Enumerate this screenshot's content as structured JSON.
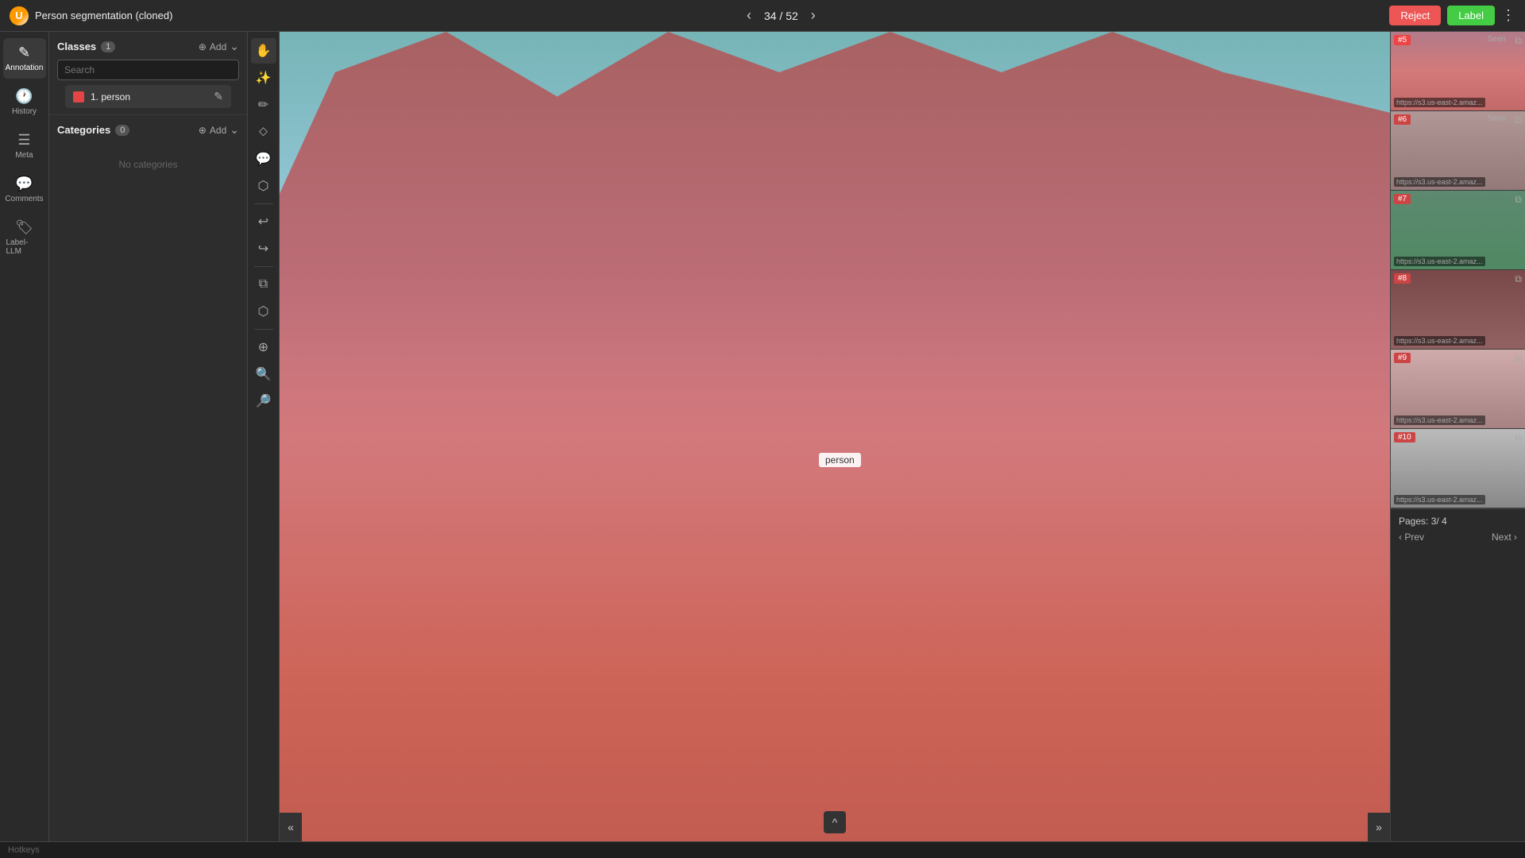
{
  "topbar": {
    "title": "Person segmentation (cloned)",
    "logo_text": "U",
    "current_page": "34",
    "total_pages": "52",
    "page_indicator": "34 / 52",
    "reject_label": "Reject",
    "label_label": "Label",
    "more_icon": "⋮"
  },
  "sidebar": {
    "items": [
      {
        "id": "annotation",
        "icon": "✎",
        "label": "Annotation"
      },
      {
        "id": "history",
        "icon": "🕐",
        "label": "History"
      },
      {
        "id": "meta",
        "icon": "☰",
        "label": "Meta"
      },
      {
        "id": "comments",
        "icon": "💬",
        "label": "Comments"
      },
      {
        "id": "label-llm",
        "icon": "🏷",
        "label": "Label-LLM"
      }
    ]
  },
  "classes_panel": {
    "title": "Classes",
    "count": "1",
    "add_label": "Add",
    "search_placeholder": "Search",
    "search_value": "",
    "classes": [
      {
        "id": 1,
        "name": "1. person",
        "color": "#e44444"
      }
    ],
    "categories_title": "Categories",
    "categories_count": "0",
    "no_categories_text": "No categories"
  },
  "tools": [
    {
      "id": "select",
      "icon": "✋",
      "label": "Select"
    },
    {
      "id": "smart",
      "icon": "✨",
      "label": "Smart"
    },
    {
      "id": "brush",
      "icon": "✏",
      "label": "Brush"
    },
    {
      "id": "erase",
      "icon": "⬦",
      "label": "Erase"
    },
    {
      "id": "comment",
      "icon": "💬",
      "label": "Comment"
    },
    {
      "id": "filter",
      "icon": "⬡",
      "label": "Filter"
    },
    {
      "id": "undo",
      "icon": "↩",
      "label": "Undo"
    },
    {
      "id": "redo",
      "icon": "↪",
      "label": "Redo"
    },
    {
      "id": "copy",
      "icon": "⧉",
      "label": "Copy"
    },
    {
      "id": "paste",
      "icon": "⬡",
      "label": "Paste"
    },
    {
      "id": "zoom-fit",
      "icon": "⊕",
      "label": "Zoom fit"
    },
    {
      "id": "zoom-in",
      "icon": "🔍",
      "label": "Zoom in"
    },
    {
      "id": "zoom-out",
      "icon": "🔎",
      "label": "Zoom out"
    }
  ],
  "canvas": {
    "annotation_label": "person"
  },
  "thumbnails": [
    {
      "id": "#5",
      "seen": "Seen",
      "url": "https://s3.us-east-2.amaz...",
      "has_red": true,
      "has_green": false,
      "active": true
    },
    {
      "id": "#6",
      "seen": "Seen",
      "url": "https://s3.us-east-2.amaz...",
      "has_red": false,
      "has_green": false,
      "active": false
    },
    {
      "id": "#7",
      "seen": "",
      "url": "https://s3.us-east-2.amaz...",
      "has_red": true,
      "has_green": true,
      "active": false
    },
    {
      "id": "#8",
      "seen": "",
      "url": "https://s3.us-east-2.amaz...",
      "has_red": true,
      "has_green": false,
      "active": false
    },
    {
      "id": "#9",
      "seen": "",
      "url": "https://s3.us-east-2.amaz...",
      "has_red": true,
      "has_green": false,
      "active": false
    },
    {
      "id": "#10",
      "seen": "",
      "url": "https://s3.us-east-2.amaz...",
      "has_red": false,
      "has_green": false,
      "active": false
    }
  ],
  "pagination": {
    "pages_label": "Pages:",
    "current": "3",
    "total": "4",
    "pages_display": "Pages:  3/ 4",
    "prev_label": "‹ Prev",
    "next_label": "Next ›"
  },
  "hotkeys": {
    "label": "Hotkeys"
  }
}
